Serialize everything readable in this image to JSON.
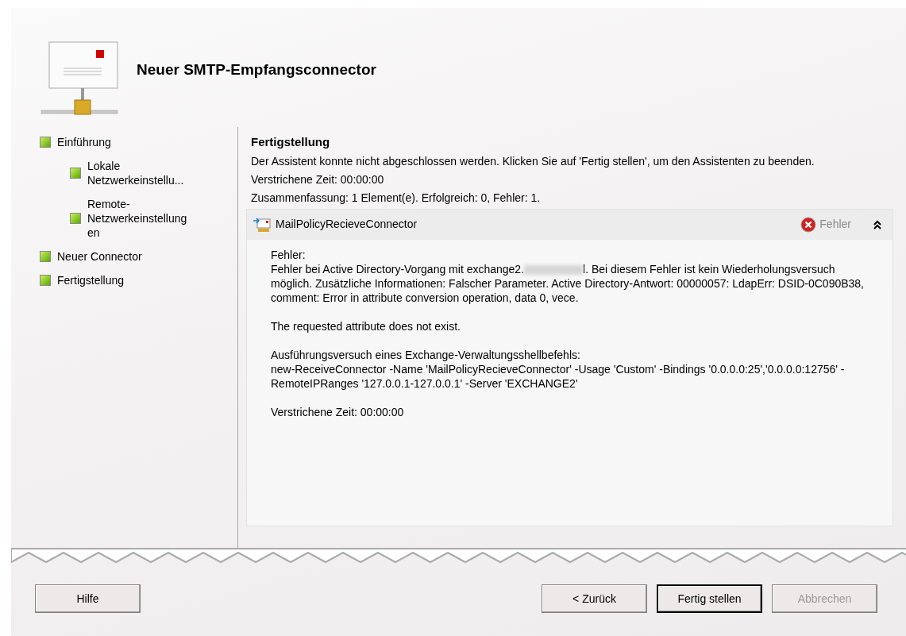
{
  "window": {
    "title": "Neuer SMTP-Empfangsconnector"
  },
  "steps": [
    {
      "label": "Einführung",
      "completed": true,
      "children": [
        {
          "label": "Lokale Netzwerkeinstellu...",
          "completed": true
        },
        {
          "label": "Remote-Netzwerkeinstellungen",
          "completed": true
        }
      ]
    },
    {
      "label": "Neuer Connector",
      "completed": true
    },
    {
      "label": "Fertigstellung",
      "completed": true
    }
  ],
  "page": {
    "heading": "Fertigstellung",
    "lines": [
      "Der Assistent konnte nicht abgeschlossen werden. Klicken Sie auf 'Fertig stellen', um den Assistenten zu beenden.",
      "Verstrichene Zeit: 00:00:00",
      "Zusammenfassung: 1 Element(e). Erfolgreich: 0, Fehler: 1."
    ]
  },
  "result": {
    "name": "MailPolicyRecieveConnector",
    "failed": true,
    "status_label": "Fehler",
    "expanded": true,
    "details": [
      {
        "kind": "text",
        "text": "Fehler:"
      },
      {
        "kind": "redacted",
        "before": "Fehler bei Active Directory-Vorgang mit exchange2.",
        "after": "l. Bei diesem Fehler ist kein Wiederholungsversuch möglich. Zusätzliche Informationen: Falscher Parameter. Active Directory-Antwort: 00000057: LdapErr: DSID-0C090B38, comment: Error in attribute conversion operation, data 0, vece."
      },
      {
        "kind": "text",
        "text": "The requested attribute does not exist."
      },
      {
        "kind": "text",
        "text": "Ausführungsversuch eines Exchange-Verwaltungsshellbefehls:"
      },
      {
        "kind": "text",
        "text": "new-ReceiveConnector -Name 'MailPolicyRecieveConnector' -Usage 'Custom' -Bindings '0.0.0.0:25','0.0.0.0:12756' -RemoteIPRanges '127.0.0.1-127.0.0.1' -Server 'EXCHANGE2'"
      },
      {
        "kind": "text",
        "text": "Verstrichene Zeit: 00:00:00"
      }
    ]
  },
  "help_button": {
    "label": "Hilfe"
  },
  "buttons": [
    {
      "label": "< Zurück",
      "disabled": false,
      "default": false
    },
    {
      "label": "Fertig stellen",
      "disabled": false,
      "default": true
    },
    {
      "label": "Abbrechen",
      "disabled": true,
      "default": false
    }
  ]
}
